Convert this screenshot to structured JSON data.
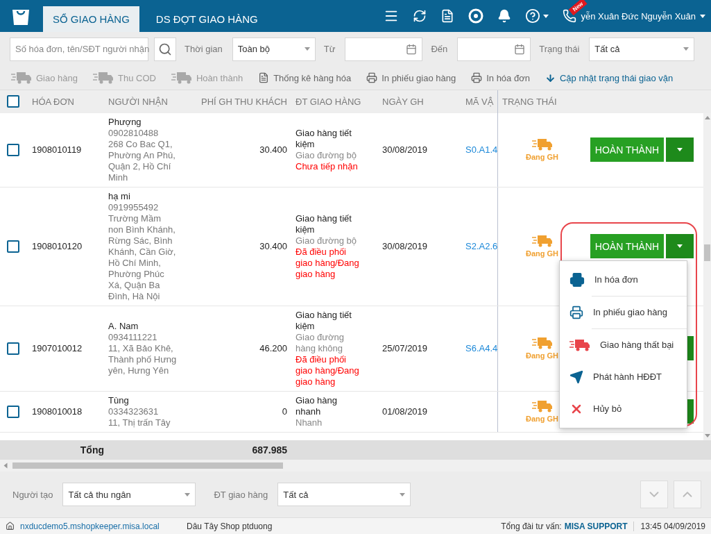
{
  "app": {
    "tabs": [
      {
        "label": "SỔ GIAO HÀNG",
        "selected": true
      },
      {
        "label": "DS ĐỢT GIAO HÀNG",
        "selected": false
      }
    ],
    "new_badge": "New",
    "user": "yễn Xuân Đức Nguyễn Xuân"
  },
  "filters": {
    "search_placeholder": "Số hóa đơn, tên/SĐT người nhận",
    "time_label": "Thời gian",
    "time_value": "Toàn bộ",
    "from_label": "Từ",
    "to_label": "Đến",
    "status_label": "Trạng thái",
    "status_value": "Tất cả"
  },
  "toolbar": [
    {
      "label": "Giao hàng",
      "kind": "truck",
      "disabled": true
    },
    {
      "label": "Thu COD",
      "kind": "truck",
      "disabled": true
    },
    {
      "label": "Hoàn thành",
      "kind": "truck",
      "disabled": true
    },
    {
      "label": "Thống kê hàng hóa",
      "kind": "list",
      "disabled": false
    },
    {
      "label": "In phiếu giao hàng",
      "kind": "printer",
      "disabled": false
    },
    {
      "label": "In hóa đơn",
      "kind": "printer",
      "disabled": false
    },
    {
      "label": "Cập nhật trạng thái giao vận",
      "kind": "update",
      "disabled": false
    }
  ],
  "table": {
    "all_checked": false,
    "columns": [
      "HÓA ĐƠN",
      "NGƯỜI NHẬN",
      "PHÍ GH THU KHÁCH",
      "ĐT GIAO HÀNG",
      "NGÀY GH",
      "MÃ VẬ",
      "TRẠNG THÁI"
    ],
    "rows": [
      {
        "checked": false,
        "invoice": "1908010119",
        "name": "Phượng",
        "phone": "0902810488",
        "address": "268 Co Bac Q1, Phường An Phú, Quận 2, Hồ Chí Minh",
        "fee": "30.400",
        "carrier": "Giao hàng tiết kiệm",
        "service": "Giao đường bộ",
        "carrier_status": "Chưa tiếp nhận",
        "date": "30/08/2019",
        "tracking": "S0.A1.4",
        "status": "Đang GH",
        "action_label": "HOÀN THÀNH"
      },
      {
        "checked": false,
        "invoice": "1908010120",
        "name": "hạ mi",
        "phone": "0919955492",
        "address": "Trường Mầm non Bình Khánh, Rừng Sác, Bình Khánh, Cần Giờ, Hồ Chí Minh, Phường Phúc Xá, Quận Ba Đình, Hà Nội",
        "fee": "30.400",
        "carrier": "Giao hàng tiết kiệm",
        "service": "Giao đường bộ",
        "carrier_status": "Đã điều phối giao hàng/Đang giao hàng",
        "date": "30/08/2019",
        "tracking": "S2.A2.6",
        "status": "Đang GH",
        "action_label": "HOÀN THÀNH",
        "menu": {
          "highlighted": true,
          "items": [
            {
              "label": "In hóa đơn",
              "kind": "printer",
              "divider_after": true
            },
            {
              "label": "In phiếu giao hàng",
              "kind": "slip",
              "divider_after": true
            },
            {
              "label": "Giao hàng thất bại",
              "kind": "failed",
              "divider_after": false
            },
            {
              "label": "Phát hành HĐĐT",
              "kind": "send",
              "divider_after": false
            },
            {
              "label": "Hủy bỏ",
              "kind": "cancel",
              "divider_after": false
            }
          ]
        }
      },
      {
        "checked": false,
        "invoice": "1907010012",
        "name": "A. Nam",
        "phone": "0934111221",
        "address": "11, Xã Bảo Khê, Thành phố Hưng yên, Hưng Yên",
        "fee": "46.200",
        "carrier": "Giao hàng tiết kiệm",
        "service": "Giao đường hàng không",
        "carrier_status": "Đã điều phối giao hàng/Đang giao hàng",
        "date": "25/07/2019",
        "tracking": "S6.A4.4",
        "status": "Đang GH"
      },
      {
        "checked": false,
        "invoice": "1908010018",
        "name": "Tùng",
        "phone": "0334323631",
        "address": "11, Thị trấn Tây",
        "fee": "0",
        "carrier": "Giao hàng nhanh",
        "service": "Nhanh",
        "date": "01/08/2019",
        "status": "Đang GH"
      }
    ],
    "total_label": "Tổng",
    "total_fee": "687.985"
  },
  "bottom_filters": [
    {
      "label": "Người tạo",
      "value": "Tất cả thu ngân"
    },
    {
      "label": "ĐT giao hàng",
      "value": "Tất cả"
    }
  ],
  "status_bar": {
    "site": "nxducdemo5.mshopkeeper.misa.local",
    "shop": "Dâu Tây Shop",
    "user": "ptduong",
    "hotline_label": "Tổng đài tư vấn:",
    "hotline": "MISA SUPPORT",
    "time": "13:45 04/09/2019"
  }
}
